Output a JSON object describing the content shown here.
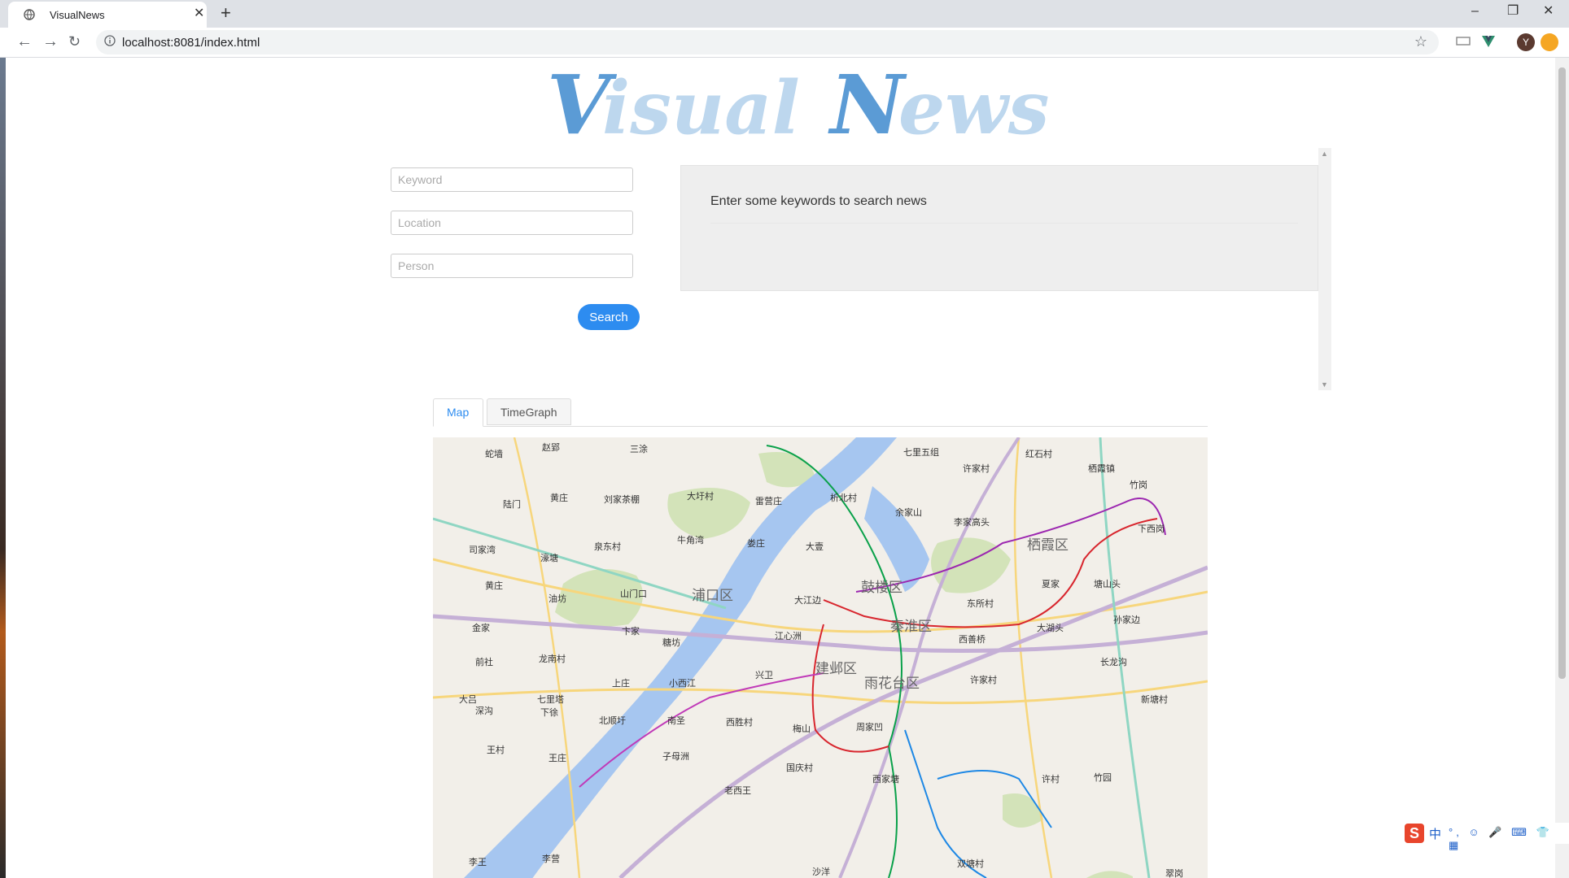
{
  "browser": {
    "tab_title": "VisualNews",
    "tab_close": "✕",
    "new_tab": "+",
    "url": "localhost:8081/index.html",
    "avatar_letter": "Y",
    "controls": {
      "minimize": "–",
      "restore": "❐",
      "close": "✕"
    }
  },
  "page": {
    "logo_text": "VisualNews",
    "logo_colors": {
      "dark": "#5b9bd5",
      "light": "#bdd7ee"
    },
    "form": {
      "keyword_placeholder": "Keyword",
      "location_placeholder": "Location",
      "person_placeholder": "Person",
      "search_label": "Search"
    },
    "results_message": "Enter some keywords to search news",
    "tabs": {
      "map": "Map",
      "timegraph": "TimeGraph",
      "active": "Map"
    },
    "map": {
      "districts": [
        "栖霞区",
        "鼓楼区",
        "浦口区",
        "秦淮区",
        "建邺区",
        "雨花台区"
      ],
      "places": [
        "蛇墙",
        "赵郢",
        "三涂",
        "七里五组",
        "红石村",
        "栖霞镇",
        "许家村",
        "大圩村",
        "雷营庄",
        "陆门",
        "黄庄",
        "刘家茶棚",
        "析北村",
        "余家山",
        "李家高头",
        "竹岗",
        "下西岗",
        "司家湾",
        "濠塘",
        "泉东村",
        "牛角湾",
        "娄庄",
        "大壹",
        "山门口",
        "大江边",
        "东所村",
        "夏家",
        "塘山头",
        "孙家边",
        "黄庄",
        "油坊",
        "卞家",
        "卜家",
        "江心洲",
        "西善桥",
        "大湖头",
        "金家",
        "糖坊",
        "长龙沟",
        "龙南村",
        "上庄",
        "小西江",
        "兴卫",
        "许家村",
        "前社",
        "大吕",
        "七里塔",
        "深沟",
        "下徐",
        "北顺圩",
        "南圣",
        "西胜村",
        "梅山",
        "周家凹",
        "新塘村",
        "王村",
        "王庄",
        "子母洲",
        "国庆村",
        "西家塘",
        "许村",
        "竹园",
        "李王",
        "李营",
        "老西王",
        "双塘村",
        "沙洋",
        "翠岗"
      ]
    },
    "ime": {
      "logo": "S",
      "lang": "中",
      "icons": "°, ☺ 🎤 ⌨ 👕 ▦"
    }
  }
}
